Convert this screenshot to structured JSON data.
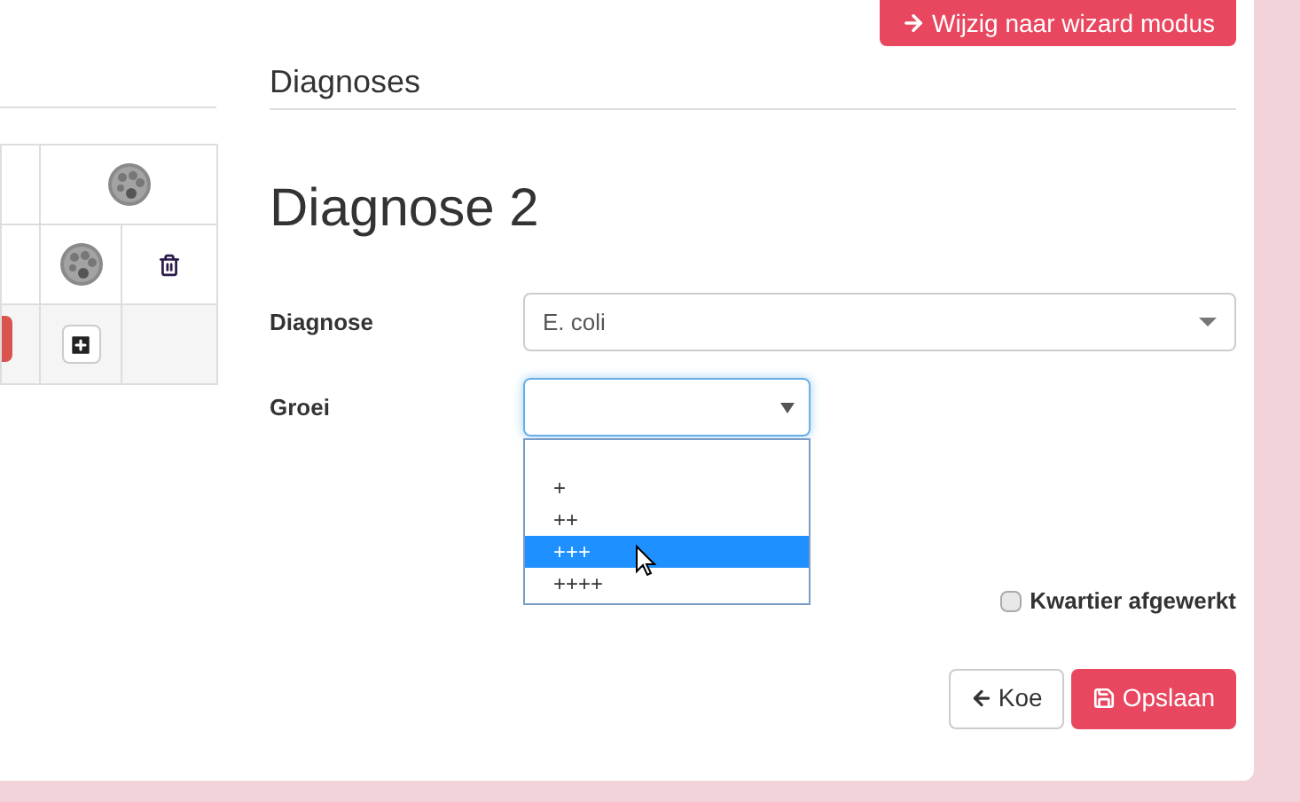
{
  "top_button": {
    "label": "Wijzig naar wizard modus"
  },
  "table": {
    "rows": [
      {
        "cells": [
          {
            "kind": "blank"
          },
          {
            "kind": "dish"
          }
        ]
      },
      {
        "cells": [
          {
            "kind": "blank"
          },
          {
            "kind": "dish"
          },
          {
            "kind": "delete"
          }
        ]
      },
      {
        "cells": [
          {
            "kind": "danger"
          },
          {
            "kind": "add"
          },
          {
            "kind": "blank"
          }
        ]
      }
    ]
  },
  "section_title": "Diagnoses",
  "form_title": "Diagnose 2",
  "fields": [
    {
      "label": "Diagnose",
      "value": "E. coli",
      "kind": "select"
    },
    {
      "label": "Groei",
      "kind": "open-select"
    }
  ],
  "dropdown": {
    "options": [
      {
        "label": "+",
        "selected": false
      },
      {
        "label": "++",
        "selected": false
      },
      {
        "label": "+++",
        "selected": true
      },
      {
        "label": "++++",
        "selected": false
      }
    ]
  },
  "checkbox": {
    "label": "Kwartier afgewerkt",
    "checked": false
  },
  "buttons": [
    {
      "label": "Koe",
      "kind": "back"
    },
    {
      "label": "Opslaan",
      "kind": "save"
    }
  ]
}
